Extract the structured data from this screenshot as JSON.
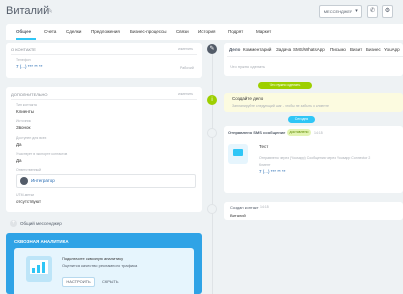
{
  "header": {
    "title": "Виталий",
    "actions_label": "МЕССЕНДЖЕРЫ"
  },
  "tabs": [
    "Общее",
    "Счета",
    "Сделки",
    "Предложения",
    "Бизнес-процессы",
    "Связи",
    "История",
    "Подрят",
    "Маркет"
  ],
  "about": {
    "heading": "О КОНТАКТЕ",
    "change": "изменить",
    "phone_label": "Телефон",
    "phone_value": "7 (...) *** ** **",
    "phone_type": "Рабочий"
  },
  "extra": {
    "heading": "ДОПОЛНИТЕЛЬНО",
    "change": "изменить",
    "fields": [
      {
        "label": "Тип контакта",
        "value": "Клиенты"
      },
      {
        "label": "Источник",
        "value": "Звонок"
      },
      {
        "label": "Доступен для всех",
        "value": "Да"
      },
      {
        "label": "Участвует в экспорте контактов",
        "value": "Да"
      },
      {
        "label": "Ответственный",
        "value": "Интегратор"
      },
      {
        "label": "UTM-метки",
        "value": "отсутствуют"
      }
    ]
  },
  "aside": {
    "add_section": "Общий мессенджер"
  },
  "promo": {
    "title": "СКВОЗНАЯ АНАЛИТИКА",
    "line1": "Подключите сквозную аналитику",
    "line2": "Оценится качество рекламного трафика",
    "configure": "НАСТРОИТЬ",
    "hide": "СКРЫТЬ"
  },
  "timeline": {
    "composer_tabs": [
      "Дело",
      "Комментарий",
      "Задача",
      "SMS/WhatsApp",
      "Письмо",
      "Визит",
      "Бизнес",
      "YouApp",
      "Ещё"
    ],
    "placeholder": "Что нужно сделать",
    "pill_planned": "Что нужно сделать",
    "todo_title": "Создайте дело",
    "todo_text": "Запланируйте следующий шаг - чтобы не забыть о клиенте",
    "pill_today": "Сегодня",
    "message_title": "Отправлено SMS сообщение",
    "message_badge": "доставлено",
    "message_time": "14:15",
    "message_text": "Тест",
    "message_meta": "Отправлено через (Yousapp) Сообщения через Yousapp Connector 2",
    "message_client": "Клиент",
    "message_phone": "7 (...) *** ** **",
    "created_title": "Создан контакт",
    "created_time": "14:15",
    "created_name": "Виталий"
  }
}
